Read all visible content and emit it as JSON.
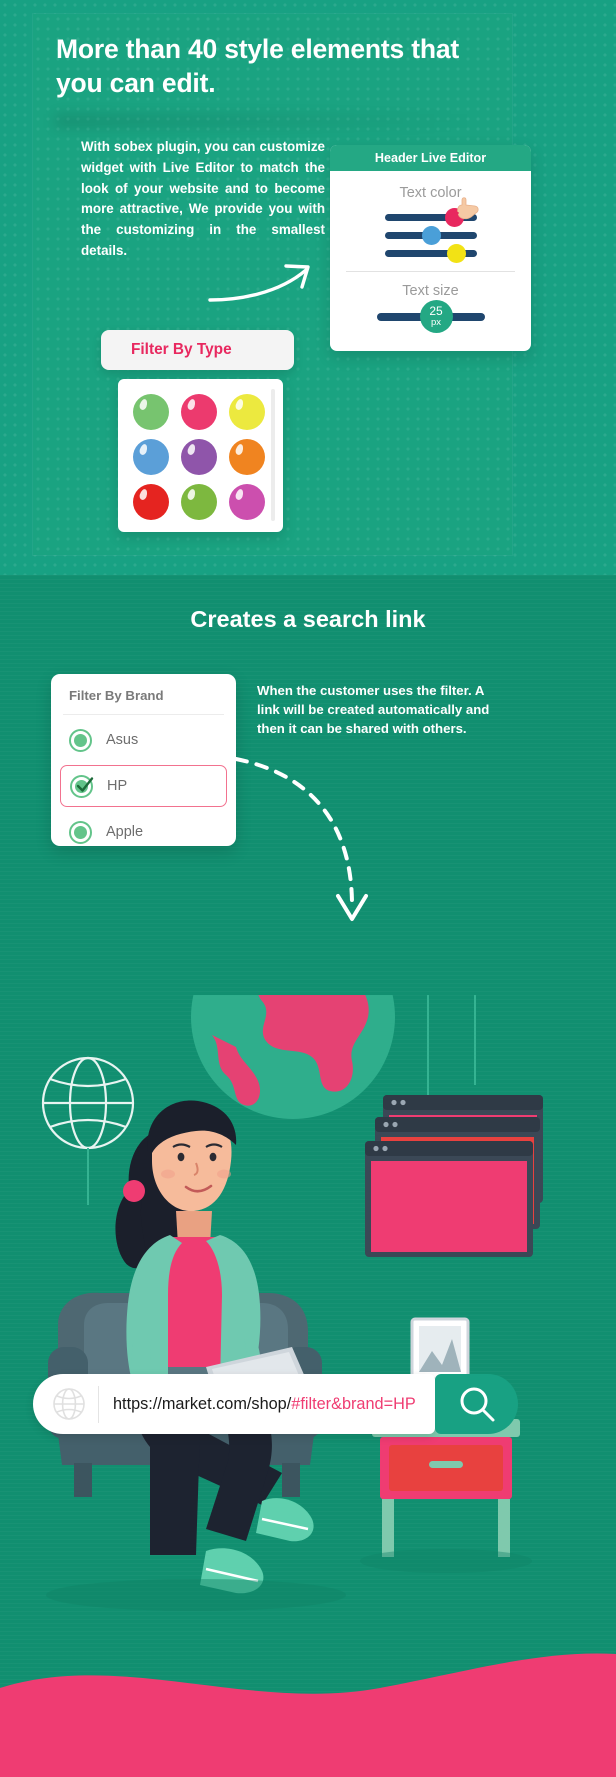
{
  "section_one": {
    "heading": "More than 40 style elements that you can edit.",
    "body": "With sobex plugin, you can customize widget with Live Editor to match the look of your website and to become more attractive, We provide you with the customizing in the smallest details.",
    "live_editor": {
      "title": "Header Live Editor",
      "text_color_label": "Text color",
      "text_size_label": "Text size",
      "size_value": "25",
      "size_unit": "px",
      "color_knobs": [
        "#e8285f",
        "#4a9fd8",
        "#f2e215"
      ],
      "track_color": "#1f466e",
      "badge_color": "#24a884"
    },
    "filter_type": {
      "label": "Filter By Type",
      "label_color": "#e8285f",
      "swatches": [
        "#77c островmen",
        "#ec3a6e",
        "#ece93f",
        "#5b9fd8",
        "#8f55aa",
        "#f08420",
        "#e52420",
        "#7db83f",
        "#cc4fae"
      ]
    }
  },
  "section_two": {
    "heading": "Creates a search link",
    "brand_filter": {
      "title": "Filter By Brand",
      "options": [
        {
          "label": "Asus",
          "selected": false
        },
        {
          "label": "HP",
          "selected": true
        },
        {
          "label": "Apple",
          "selected": false
        }
      ],
      "accent_color": "#63c48a",
      "selected_outline": "#f2728f"
    },
    "description": "When the customer uses the filter. A link will be created automatically and then it can be shared with others.",
    "search_bar": {
      "url_base": "https://market.com/shop/",
      "url_fragment": "#filter&brand=HP",
      "fragment_color": "#ef3c72",
      "globe_icon": "globe-icon",
      "search_icon": "search-icon",
      "button_color": "#18a183"
    }
  },
  "theme": {
    "section_one_bg": "#18a183",
    "section_two_bg": "#118f70",
    "pink": "#ec3a6e"
  }
}
